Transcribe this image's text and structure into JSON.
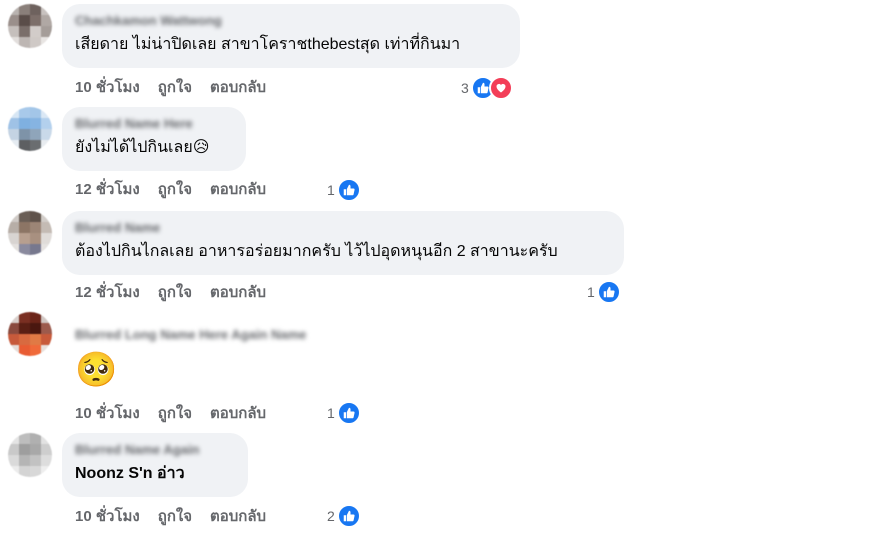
{
  "colors": {
    "like": "#1877f2",
    "love": "#f33e58",
    "bubble": "#f0f2f5",
    "meta": "#65676b"
  },
  "actions": {
    "like_label": "ถูกใจ",
    "reply_label": "ตอบกลับ"
  },
  "comments": [
    {
      "author": "Chachkamon Wattwong",
      "text": "เสียดาย ไม่น่าปิดเลย สาขาโคราชthebestสุด เท่าที่กินมา",
      "time": "10 ชั่วโมง",
      "reaction_count": "3",
      "reactions": [
        "like-icon",
        "love-icon"
      ]
    },
    {
      "author": "Blurred Name Here",
      "text": "ยังไม่ได้ไปกินเลย😥",
      "time": "12 ชั่วโมง",
      "reaction_count": "1",
      "reactions": [
        "like-icon"
      ]
    },
    {
      "author": "Blurred Name",
      "text": "ต้องไปกินไกลเลย อาหารอร่อยมากครับ ไว้ไปอุดหนุนอีก 2 สาขานะครับ",
      "time": "12 ชั่วโมง",
      "reaction_count": "1",
      "reactions": [
        "like-icon"
      ]
    },
    {
      "author": "Blurred Long Name Here Again Name",
      "text": "🥺",
      "time": "10 ชั่วโมง",
      "reaction_count": "1",
      "reactions": [
        "like-icon"
      ]
    },
    {
      "author": "Blurred Name Again",
      "text": "Noonz S'n อ่าว",
      "time": "10 ชั่วโมง",
      "reaction_count": "2",
      "reactions": [
        "like-icon"
      ]
    }
  ]
}
